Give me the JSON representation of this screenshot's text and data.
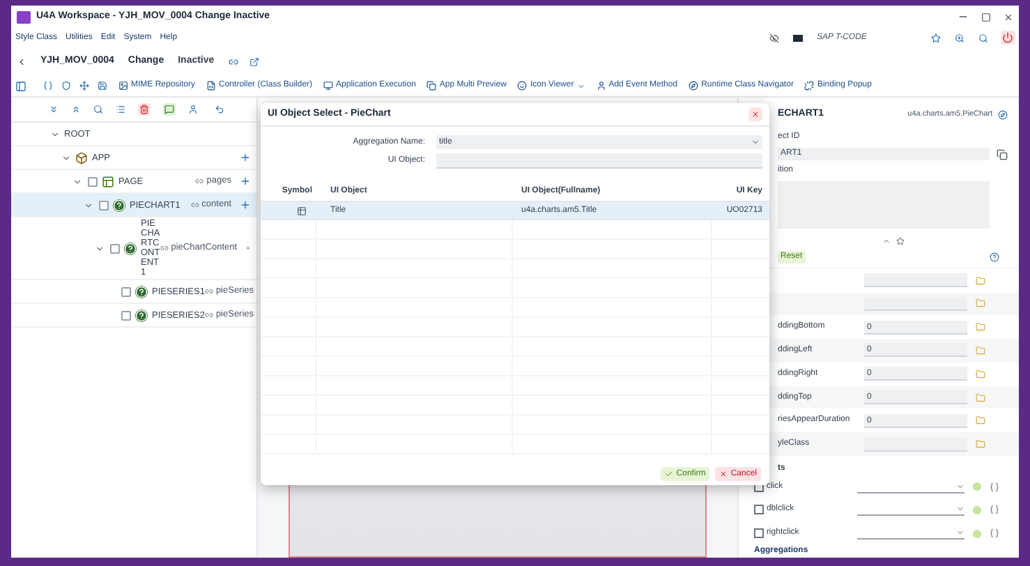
{
  "window": {
    "title": "U4A Workspace - YJH_MOV_0004 Change Inactive"
  },
  "menu": {
    "items": [
      "Style Class",
      "Utilities",
      "Edit",
      "System",
      "Help"
    ],
    "tcode": "SAP T-CODE"
  },
  "header": {
    "app_id": "YJH_MOV_0004",
    "mode": "Change",
    "status": "Inactive"
  },
  "toolbar": [
    {
      "label": "MIME Repository",
      "dropdown": false
    },
    {
      "label": "Controller (Class Builder)",
      "dropdown": false
    },
    {
      "label": "Application Execution",
      "dropdown": false
    },
    {
      "label": "App Multi Preview",
      "dropdown": false
    },
    {
      "label": "Icon Viewer",
      "dropdown": true
    },
    {
      "label": "Add Event Method",
      "dropdown": false
    },
    {
      "label": "Runtime Class Navigator",
      "dropdown": false
    },
    {
      "label": "Binding Popup",
      "dropdown": false
    }
  ],
  "tree": [
    {
      "name": "ROOT",
      "kind": "root",
      "expanded": true,
      "selected": false,
      "children": [
        {
          "name": "APP",
          "kind": "app",
          "expanded": true,
          "selected": false,
          "children": [
            {
              "name": "PAGE",
              "kind": "page",
              "aggregation": "pages",
              "checked": false,
              "expanded": true,
              "selected": false,
              "children": [
                {
                  "name": "PIECHART1",
                  "kind": "control",
                  "aggregation": "content",
                  "checked": false,
                  "expanded": true,
                  "selected": true,
                  "children": [
                    {
                      "name": "PIECHARTCONTENT1",
                      "kind": "control",
                      "aggregation": "pieChartContent",
                      "checked": false,
                      "expanded": true,
                      "selected": false,
                      "children": [
                        {
                          "name": "PIESERIES1",
                          "kind": "control",
                          "aggregation": "pieSeries",
                          "checked": false,
                          "selected": false
                        },
                        {
                          "name": "PIESERIES2",
                          "kind": "control",
                          "aggregation": "pieSeries",
                          "checked": false,
                          "selected": false
                        }
                      ]
                    }
                  ]
                }
              ]
            }
          ]
        }
      ]
    }
  ],
  "dialog": {
    "title": "UI Object Select - PieChart",
    "aggregation_name": {
      "label": "Aggregation Name:",
      "value": "title"
    },
    "ui_object": {
      "label": "UI Object:"
    },
    "columns": [
      "Symbol",
      "UI Object",
      "UI Object(Fullname)",
      "UI Key"
    ],
    "rows": [
      {
        "ui_object": "Title",
        "fullname": "u4a.charts.am5.Title",
        "ui_key": "UO02713",
        "selected": true
      }
    ],
    "buttons": [
      "Confirm",
      "Cancel"
    ]
  },
  "properties_panel": {
    "title": "ECHART1",
    "class_name": "u4a.charts.am5.PieChart",
    "id_label": "ect ID",
    "id_value": "ART1",
    "description_label": "ition",
    "reset": "Reset",
    "properties": [
      {
        "kind": "input"
      },
      {
        "kind": "input"
      },
      {
        "kind": "input",
        "name": "ddingBottom",
        "value": "0"
      },
      {
        "kind": "input",
        "name": "ddingLeft",
        "value": "0"
      },
      {
        "kind": "input",
        "name": "ddingRight",
        "value": "0"
      },
      {
        "kind": "input",
        "name": "ddingTop",
        "value": "0"
      },
      {
        "kind": "input",
        "name": "riesAppearDuration",
        "value": "0"
      },
      {
        "kind": "input",
        "name": "yleClass"
      }
    ],
    "events_label": "ts",
    "events": [
      {
        "name": "click",
        "checked": false
      },
      {
        "name": "dblclick",
        "checked": false
      },
      {
        "name": "rightclick",
        "checked": false
      }
    ],
    "aggregations_label": "Aggregations"
  }
}
